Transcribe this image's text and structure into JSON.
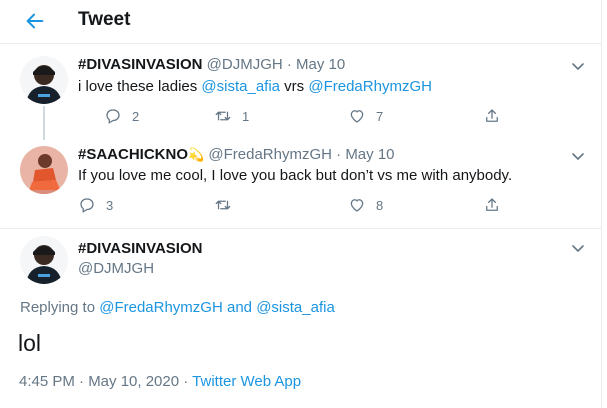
{
  "header": {
    "title": "Tweet"
  },
  "tweets": [
    {
      "name": "#DIVASINVASION",
      "handle": "@DJMJGH",
      "dot": "·",
      "time": "May 10",
      "text_prefix": "i love these ladies ",
      "mention1": "@sista_afia",
      "text_mid": " vrs ",
      "mention2": "@FredaRhymzGH",
      "replies": "2",
      "retweets": "1",
      "likes": "7"
    },
    {
      "name": "#SAACHICKNO",
      "name_emoji": "💫",
      "handle": "@FredaRhymzGH",
      "dot": "·",
      "time": "May 10",
      "text": "If you love me cool, I love you back but don’t vs me with anybody.",
      "replies": "3",
      "retweets": "",
      "likes": "8"
    }
  ],
  "main_tweet": {
    "name": "#DIVASINVASION",
    "handle": "@DJMJGH",
    "replying_prefix": "Replying to ",
    "replying_user1": "@FredaRhymzGH",
    "replying_and": " and ",
    "replying_user2": "@sista_afia",
    "text": "lol",
    "timestamp": "4:45 PM · May 10, 2020 · ",
    "source": "Twitter Web App"
  },
  "colors": {
    "accent": "#1b95e0",
    "muted": "#657786",
    "text": "#14171a",
    "border": "#e6ecf0"
  },
  "icons": [
    "back-arrow-icon",
    "chevron-down-icon",
    "reply-icon",
    "retweet-icon",
    "like-icon",
    "share-icon"
  ]
}
